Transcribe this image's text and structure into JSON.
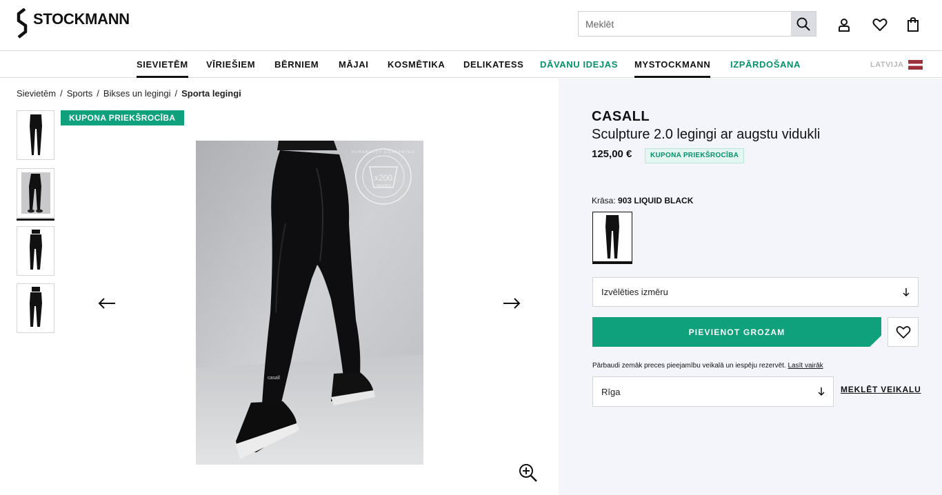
{
  "header": {
    "logo_text": "STOCKMANN",
    "search_placeholder": "Meklēt",
    "icons": [
      "search-icon",
      "user-icon",
      "heart-icon",
      "bag-icon"
    ]
  },
  "nav": {
    "items": [
      {
        "label": "SIEVIETĒM",
        "active": true
      },
      {
        "label": "VĪRIEŠIEM"
      },
      {
        "label": "BĒRNIEM"
      },
      {
        "label": "MĀJAI"
      },
      {
        "label": "KOSMĒTIKA"
      },
      {
        "label": "DELIKATESS"
      },
      {
        "label": "DĀVANU IDEJAS",
        "color": "#05906a"
      },
      {
        "label": "MYSTOCKMANN",
        "active": true
      },
      {
        "label": "IZPĀRDOŠANA",
        "color": "#05906a"
      }
    ],
    "language": "LATVIJA"
  },
  "breadcrumb": {
    "items": [
      "Sievietēm",
      "Sports",
      "Bikses un legingi"
    ],
    "current": "Sporta legingi"
  },
  "gallery": {
    "coupon_badge": "KUPONA PRIEKŠROCĪBA",
    "image_badge_text": "x200",
    "image_badge_sub": "WASHES",
    "image_badge_ring": "DURABILITY GUARANTEE",
    "legging_logo": "casall"
  },
  "product": {
    "brand": "CASALL",
    "name": "Sculpture 2.0 legingi ar augstu vidukli",
    "price": "125,00 €",
    "coupon_label": "KUPONA PRIEKŠROCĪBA",
    "color_label": "Krāsa:",
    "color_value": "903 LIQUID BLACK",
    "size_placeholder": "Izvēlēties izmēru",
    "add_to_cart": "PIEVIENOT GROZAM",
    "availability_text": "Pārbaudi zemāk preces pieejamību veikalā un iespēju rezervēt.",
    "read_more": "Lasīt vairāk",
    "city": "Rīga",
    "find_store": "MEKLĒT VEIKALU"
  },
  "colors": {
    "accent": "#0fa07c",
    "panel_bg": "#f4f5fb"
  }
}
